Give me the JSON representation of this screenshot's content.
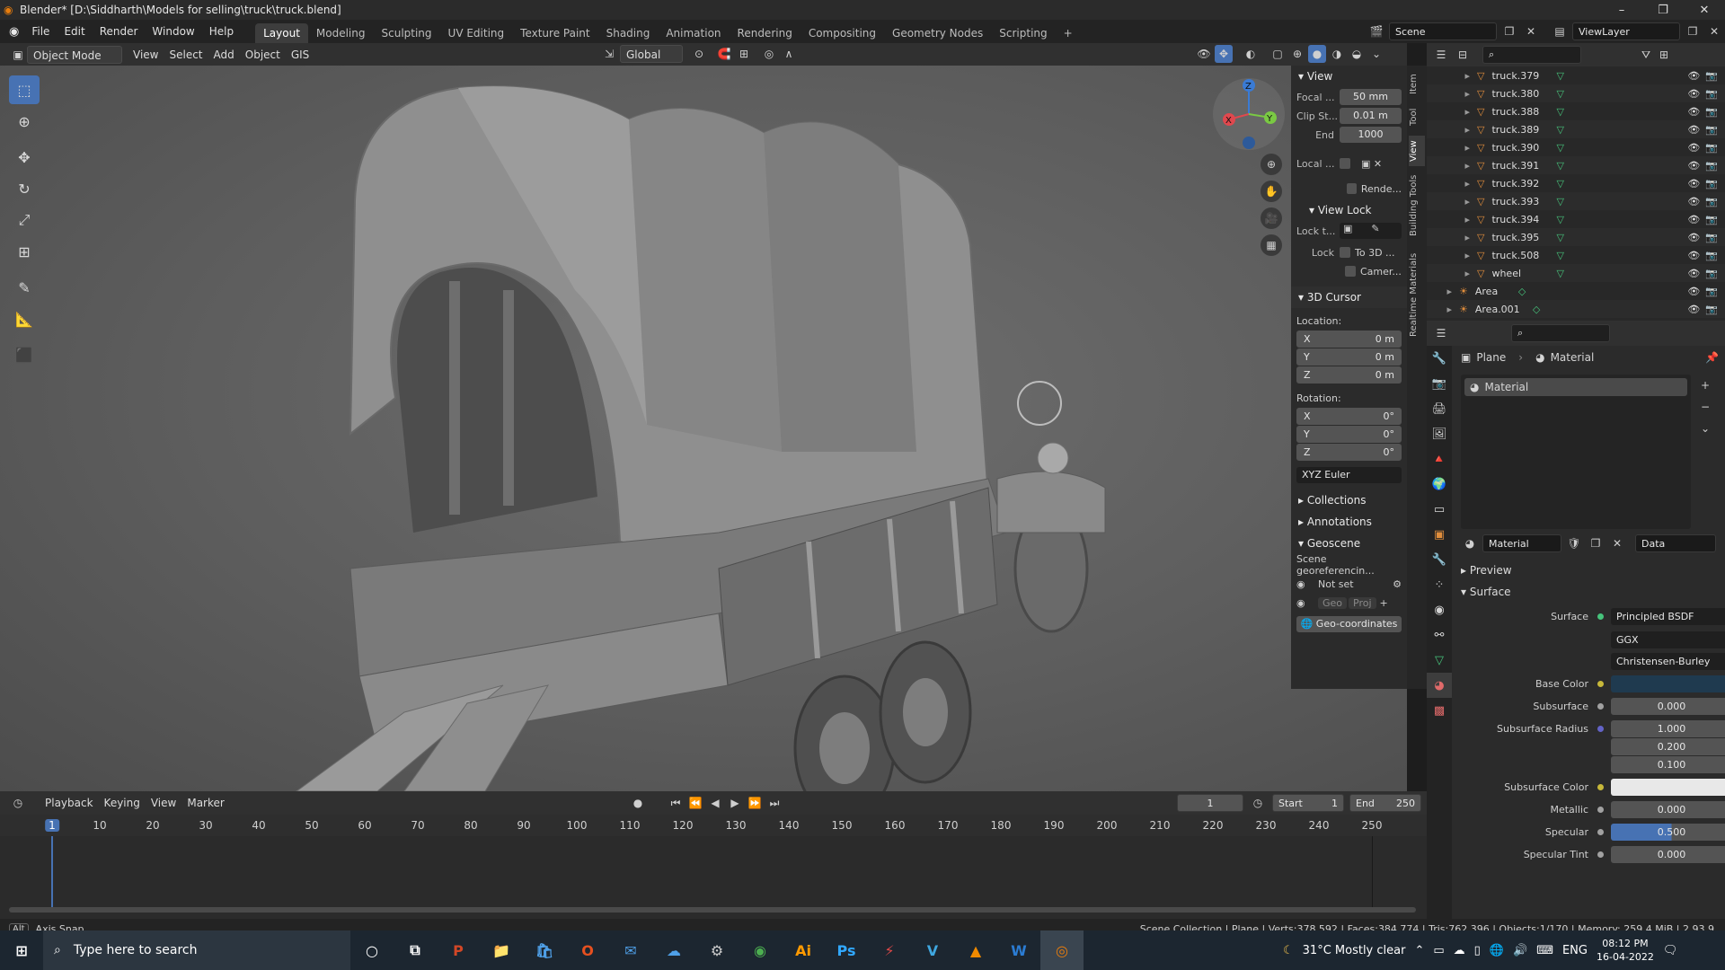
{
  "window": {
    "title": "Blender* [D:\\Siddharth\\Models for selling\\truck\\truck.blend]",
    "controls": [
      "–",
      "❐",
      "✕"
    ]
  },
  "menu": [
    "File",
    "Edit",
    "Render",
    "Window",
    "Help"
  ],
  "workspaces": [
    "Layout",
    "Modeling",
    "Sculpting",
    "UV Editing",
    "Texture Paint",
    "Shading",
    "Animation",
    "Rendering",
    "Compositing",
    "Geometry Nodes",
    "Scripting",
    "+"
  ],
  "active_workspace": "Layout",
  "scene": {
    "name": "Scene",
    "view_layer": "ViewLayer"
  },
  "viewport_header": {
    "mode": "Object Mode",
    "menus": [
      "View",
      "Select",
      "Add",
      "Object",
      "GIS"
    ],
    "orientation": "Global"
  },
  "npanel": {
    "view_title": "View",
    "focal_label": "Focal ...",
    "focal_value": "50 mm",
    "clip_start_label": "Clip St...",
    "clip_start_value": "0.01 m",
    "clip_end_label": "End",
    "clip_end_value": "1000",
    "local_label": "Local ...",
    "render_label": "Rende...",
    "view_lock_title": "View Lock",
    "lock_to_label": "Lock t...",
    "lock_label": "Lock",
    "to3d_label": "To 3D ...",
    "camera_label": "Camer...",
    "cursor_title": "3D Cursor",
    "location_label": "Location:",
    "loc": {
      "x": "0 m",
      "y": "0 m",
      "z": "0 m"
    },
    "rotation_label": "Rotation:",
    "rot": {
      "x": "0°",
      "y": "0°",
      "z": "0°"
    },
    "rotation_mode": "XYZ Euler",
    "collections": "Collections",
    "annotations": "Annotations",
    "geoscene": "Geoscene",
    "georef": "Scene georeferencin...",
    "not_set": "Not set",
    "geo_btn": "Geo",
    "proj_btn": "Proj",
    "geocoords": "Geo-coordinates"
  },
  "side_tabs": [
    "Item",
    "Tool",
    "View",
    "Building Tools",
    "Realtime Materials"
  ],
  "outliner": {
    "rows": [
      {
        "name": "truck.379",
        "type": "mesh"
      },
      {
        "name": "truck.380",
        "type": "mesh"
      },
      {
        "name": "truck.388",
        "type": "mesh"
      },
      {
        "name": "truck.389",
        "type": "mesh"
      },
      {
        "name": "truck.390",
        "type": "mesh"
      },
      {
        "name": "truck.391",
        "type": "mesh"
      },
      {
        "name": "truck.392",
        "type": "mesh"
      },
      {
        "name": "truck.393",
        "type": "mesh"
      },
      {
        "name": "truck.394",
        "type": "mesh"
      },
      {
        "name": "truck.395",
        "type": "mesh"
      },
      {
        "name": "truck.508",
        "type": "mesh"
      },
      {
        "name": "wheel",
        "type": "mesh"
      },
      {
        "name": "Area",
        "type": "light"
      },
      {
        "name": "Area.001",
        "type": "light"
      }
    ]
  },
  "properties": {
    "object": "Plane",
    "material_tab": "Material",
    "slot": "Material",
    "material_name": "Material",
    "data_link": "Data",
    "preview": "Preview",
    "surface_section": "Surface",
    "surface_label": "Surface",
    "surface_value": "Principled BSDF",
    "distribution": "GGX",
    "subsurface_method": "Christensen-Burley",
    "base_color_label": "Base Color",
    "base_color": "#1f3a4f",
    "subsurface_label": "Subsurface",
    "subsurface_value": "0.000",
    "subsurface_radius_label": "Subsurface Radius",
    "subsurface_radius": [
      "1.000",
      "0.200",
      "0.100"
    ],
    "subsurface_color_label": "Subsurface Color",
    "subsurface_color": "#e8e8e8",
    "metallic_label": "Metallic",
    "metallic_value": "0.000",
    "specular_label": "Specular",
    "specular_value": "0.500",
    "specular_tint_label": "Specular Tint",
    "specular_tint_value": "0.000"
  },
  "timeline": {
    "menus": [
      "Playback",
      "Keying",
      "View",
      "Marker"
    ],
    "current_frame": "1",
    "start_label": "Start",
    "start": "1",
    "end_label": "End",
    "end": "250",
    "ticks": [
      "1",
      "10",
      "20",
      "30",
      "40",
      "50",
      "60",
      "70",
      "80",
      "90",
      "100",
      "110",
      "120",
      "130",
      "140",
      "150",
      "160",
      "170",
      "180",
      "190",
      "200",
      "210",
      "220",
      "230",
      "240",
      "250"
    ]
  },
  "status": {
    "left": "Axis Snap",
    "alt_key": "Alt",
    "right": "Scene Collection | Plane | Verts:378,592 | Faces:384,774 | Tris:762,396 | Objects:1/170 | Memory: 259.4 MiB | 2.93.9"
  },
  "taskbar": {
    "search_placeholder": "Type here to search",
    "weather": "31°C  Mostly clear",
    "language": "ENG",
    "time": "08:12 PM",
    "date": "16-04-2022",
    "apps": [
      "P",
      "📁",
      "🛍",
      "O",
      "✉",
      "☁",
      "⚙",
      "◉",
      "Ai",
      "Ps",
      "⚡",
      "V",
      "▲",
      "W",
      "◎"
    ]
  }
}
